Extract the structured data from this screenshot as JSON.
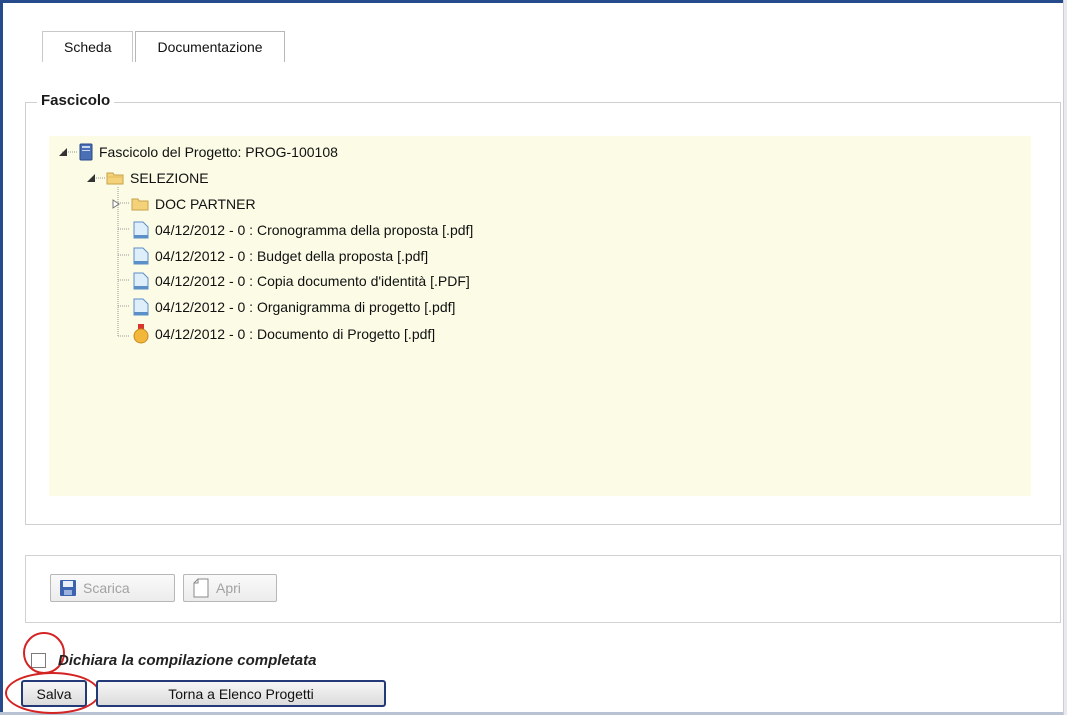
{
  "tabs": [
    {
      "label": "Scheda"
    },
    {
      "label": "Documentazione"
    }
  ],
  "fieldset": {
    "legend": "Fascicolo"
  },
  "tree": {
    "root": {
      "label": "Fascicolo del Progetto: PROG-100108",
      "icon": "binder-icon"
    },
    "folder": {
      "label": "SELEZIONE",
      "icon": "folder-open-icon"
    },
    "children": [
      {
        "label": "DOC PARTNER",
        "icon": "folder-icon"
      },
      {
        "label": "04/12/2012 - 0 : Cronogramma della proposta  [.pdf]",
        "icon": "document-icon"
      },
      {
        "label": "04/12/2012 - 0 : Budget della proposta  [.pdf]",
        "icon": "document-icon"
      },
      {
        "label": "04/12/2012 - 0 : Copia documento d'identità  [.PDF]",
        "icon": "document-icon"
      },
      {
        "label": "04/12/2012 - 0 : Organigramma di progetto  [.pdf]",
        "icon": "document-icon"
      },
      {
        "label": "04/12/2012 - 0 : Documento di Progetto  [.pdf]",
        "icon": "medal-icon"
      }
    ]
  },
  "actions": {
    "download_label": "Scarica",
    "open_label": "Apri"
  },
  "declaration": {
    "label": "Dichiara la compilazione completata",
    "checked": false
  },
  "buttons": {
    "save_label": "Salva",
    "back_label": "Torna a Elenco Progetti"
  },
  "colors": {
    "frame": "#254b8c",
    "tree_bg": "#fbfbe6",
    "annotation": "#d42323"
  }
}
